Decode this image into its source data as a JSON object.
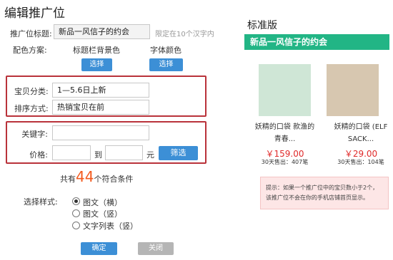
{
  "page": {
    "title": "编辑推广位"
  },
  "form": {
    "title_label": "推广位标题:",
    "title_value": "新品一风信子的约会",
    "title_hint": "限定在10个汉字内",
    "color_label": "配色方案:",
    "bg_color_label": "标题栏背景色",
    "font_color_label": "字体颜色",
    "select_label": "选择",
    "category_label": "宝贝分类:",
    "category_value": "1—5.6日上新",
    "sort_label": "排序方式:",
    "sort_value": "热销宝贝在前",
    "keyword_label": "关键字:",
    "keyword_value": "",
    "price_label": "价格:",
    "price_min": "",
    "price_to": "到",
    "price_max": "",
    "price_unit": "元",
    "filter_label": "筛选",
    "count_prefix": "共有",
    "count_value": "44",
    "count_suffix": "个符合条件",
    "style_label": "选择样式:",
    "style_options": [
      "图文（横）",
      "图文（竖）",
      "文字列表（竖）"
    ],
    "style_selected": 0,
    "confirm_label": "确定",
    "close_label": "关闭"
  },
  "preview": {
    "title": "标准版",
    "banner_text": "新品一风信子的约会",
    "banner_color": "#22b585",
    "products": [
      {
        "name_line1": "妖精的口袋 款渔的",
        "name_line2": "青春...",
        "price": "￥159.00",
        "sold": "30天售出：407笔",
        "image_color": "#cfe6d6"
      },
      {
        "name_line1": "妖精的口袋 (ELF",
        "name_line2": "SACK...",
        "price": "￥29.00",
        "sold": "30天售出：104笔",
        "image_color": "#d7c7b0"
      }
    ],
    "notice_text": "提示：如果一个推广位中的宝贝数小于2个，该推广位不会在你的手机店铺首页显示。"
  },
  "colors": {
    "accent_blue": "#3c8fd6",
    "highlight_red": "#b9323a",
    "count_orange": "#f35a1e",
    "price_red": "#e02a2a",
    "button_gray": "#b5b5b5"
  }
}
